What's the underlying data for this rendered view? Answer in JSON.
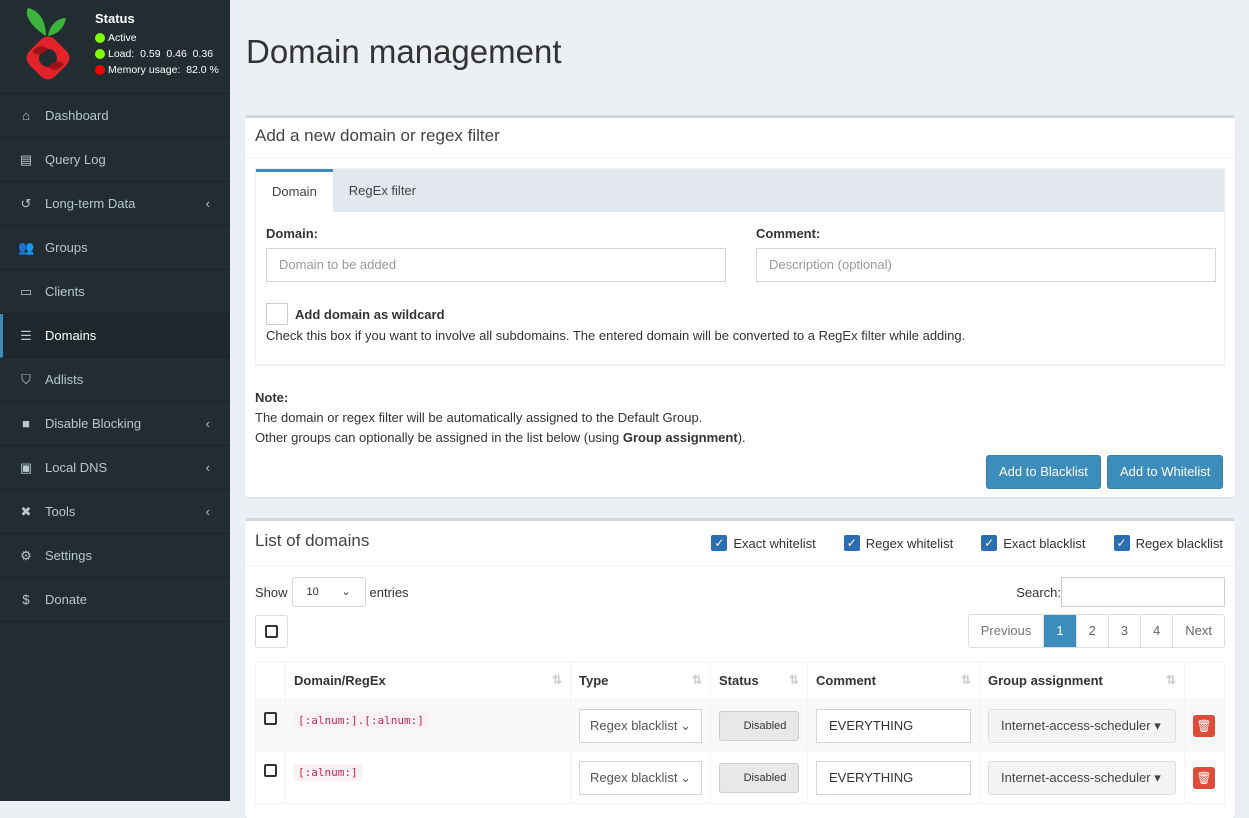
{
  "status": {
    "title": "Status",
    "active": "Active",
    "load": "Load:  0.59  0.46  0.36",
    "memory": "Memory usage:  82.0 %",
    "colors": {
      "ok": "#7fff00",
      "bad": "#ff0000"
    }
  },
  "sidebar": {
    "items": [
      {
        "label": "Dashboard",
        "icon": "home-icon"
      },
      {
        "label": "Query Log",
        "icon": "file-icon"
      },
      {
        "label": "Long-term Data",
        "icon": "history-icon",
        "chevron": true
      },
      {
        "label": "Groups",
        "icon": "users-icon"
      },
      {
        "label": "Clients",
        "icon": "laptop-icon"
      },
      {
        "label": "Domains",
        "icon": "list-icon",
        "active": true
      },
      {
        "label": "Adlists",
        "icon": "shield-icon"
      },
      {
        "label": "Disable Blocking",
        "icon": "stop-icon",
        "chevron": true
      },
      {
        "label": "Local DNS",
        "icon": "address-book-icon",
        "chevron": true
      },
      {
        "label": "Tools",
        "icon": "tools-icon",
        "chevron": true
      },
      {
        "label": "Settings",
        "icon": "gear-icon"
      },
      {
        "label": "Donate",
        "icon": "donate-icon"
      }
    ]
  },
  "page": {
    "title": "Domain management"
  },
  "add": {
    "title": "Add a new domain or regex filter",
    "tabs": [
      "Domain",
      "RegEx filter"
    ],
    "domain_label": "Domain:",
    "domain_placeholder": "Domain to be added",
    "comment_label": "Comment:",
    "comment_placeholder": "Description (optional)",
    "wildcard_label": "Add domain as wildcard",
    "wildcard_help": "Check this box if you want to involve all subdomains. The entered domain will be converted to a RegEx filter while adding.",
    "note_title": "Note:",
    "note_line1": "The domain or regex filter will be automatically assigned to the Default Group.",
    "note_line2_a": "Other groups can optionally be assigned in the list below (using ",
    "note_line2_b": "Group assignment",
    "note_line2_c": ").",
    "blacklist_btn": "Add to Blacklist",
    "whitelist_btn": "Add to Whitelist"
  },
  "list": {
    "title": "List of domains",
    "filters": [
      "Exact whitelist",
      "Regex whitelist",
      "Exact blacklist",
      "Regex blacklist"
    ],
    "show": "Show",
    "entries_value": "10",
    "entries": "entries",
    "search": "Search:",
    "pagination": [
      "Previous",
      "1",
      "2",
      "3",
      "4",
      "Next"
    ],
    "current_page": "1",
    "columns": [
      "Domain/RegEx",
      "Type",
      "Status",
      "Comment",
      "Group assignment"
    ],
    "rows": [
      {
        "domain": "[:alnum:].[:alnum:]",
        "type": "Regex blacklist",
        "status": "Disabled",
        "comment": "EVERYTHING",
        "group": "Internet-access-scheduler"
      },
      {
        "domain": "[:alnum:]",
        "type": "Regex blacklist",
        "status": "Disabled",
        "comment": "EVERYTHING",
        "group": "Internet-access-scheduler"
      }
    ]
  }
}
